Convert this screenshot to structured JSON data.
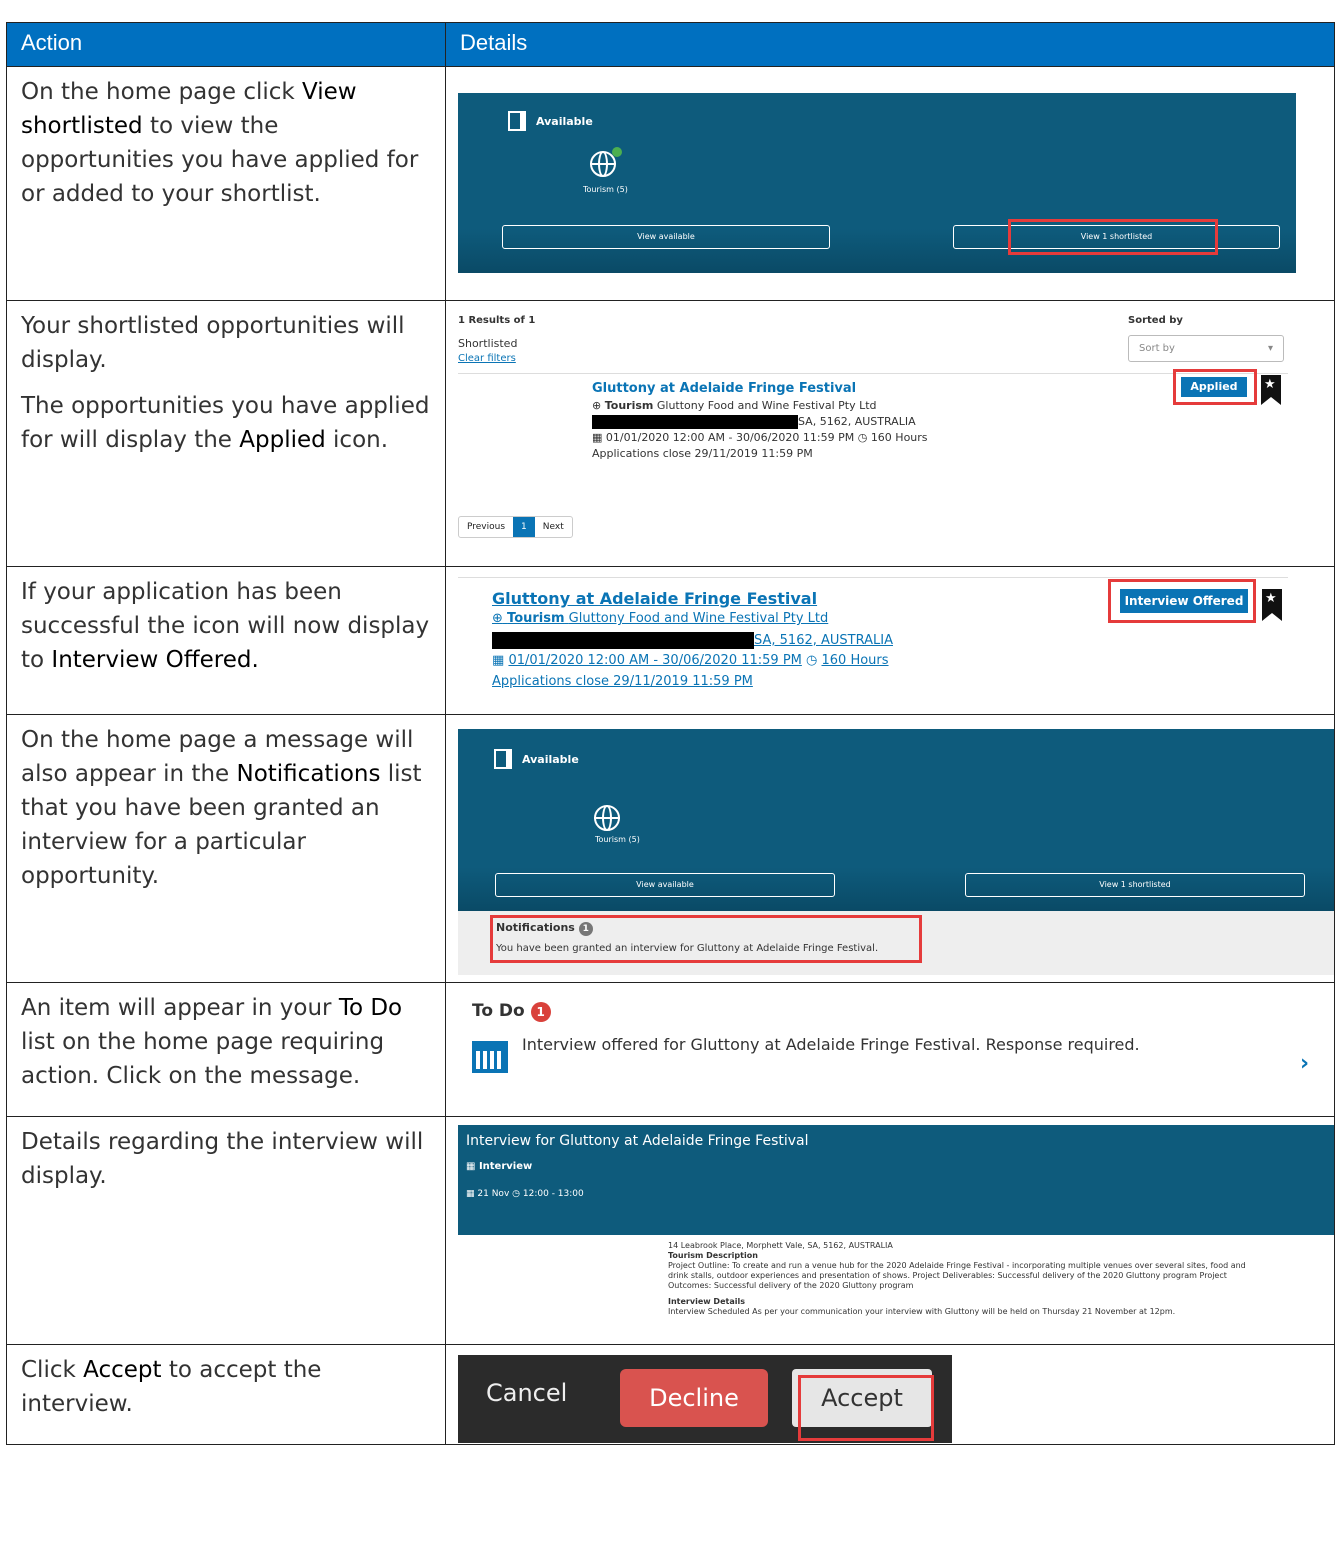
{
  "headers": {
    "action": "Action",
    "details": "Details"
  },
  "rows": {
    "r1": {
      "pre": "On the home page click ",
      "key": "View shortlisted",
      "post": " to view the opportunities you have applied for or added to your shortlist."
    },
    "r2": {
      "p1": "Your shortlisted opportunities will display.",
      "p2pre": "The opportunities you have applied for will display the ",
      "p2key": "Applied",
      "p2post": " icon."
    },
    "r3": {
      "pre": "If your application has been successful the icon will now display to ",
      "key": "Interview Offered."
    },
    "r4": {
      "pre": "On the home page a message will also appear in the ",
      "key": "Notifications",
      "post": " list that you have been granted an interview for a particular opportunity."
    },
    "r5": {
      "pre": "An item will appear in your ",
      "key": "To Do",
      "post": " list on the home page requiring action. Click on the message."
    },
    "r6": {
      "text": "Details regarding the interview will display."
    },
    "r7": {
      "key": "Accept",
      "post": " to accept the interview.",
      "pre": "Click "
    }
  },
  "home": {
    "available": "Available",
    "category": "Tourism (5)",
    "view_available": "View available",
    "view_shortlisted": "View 1 shortlisted"
  },
  "results": {
    "count": "1 Results of 1",
    "sorted_by": "Sorted by",
    "filter": "Shortlisted",
    "clear": "Clear filters",
    "sort_placeholder": "Sort by",
    "title": "Gluttony at Adelaide Fringe Festival",
    "category": "Tourism",
    "org": "Gluttony Food and Wine Festival Pty Ltd",
    "location": "SA, 5162, AUSTRALIA",
    "dates": "01/01/2020 12:00 AM - 30/06/2020 11:59 PM",
    "hours": "160 Hours",
    "closes": "Applications close 29/11/2019 11:59 PM",
    "status_applied": "Applied",
    "status_offered": "Interview Offered",
    "prev": "Previous",
    "page": "1",
    "next": "Next"
  },
  "notifications": {
    "title": "Notifications",
    "count": "1",
    "message": "You have been granted an interview for Gluttony at Adelaide Fringe Festival."
  },
  "todo": {
    "title": "To Do",
    "count": "1",
    "message": "Interview offered for Gluttony at Adelaide Fringe Festival. Response required."
  },
  "interview": {
    "title": "Interview for Gluttony at Adelaide Fringe Festival",
    "type": "Interview",
    "date": "21 Nov",
    "time": "12:00 - 13:00",
    "address": "14 Leabrook Place, Morphett Vale, SA, 5162, AUSTRALIA",
    "desc_title": "Tourism Description",
    "desc": "Project Outline: To create and run a venue hub for the 2020 Adelaide Fringe Festival - incorporating multiple venues over several sites, food and drink stalls, outdoor experiences and presentation of shows. Project Deliverables: Successful delivery of the 2020 Gluttony program Project Outcomes: Successful delivery of the 2020 Gluttony program",
    "details_title": "Interview Details",
    "details": "Interview Scheduled As per your communication your interview with Gluttony will be held on Thursday 21 November at 12pm."
  },
  "buttons": {
    "cancel": "Cancel",
    "decline": "Decline",
    "accept": "Accept"
  }
}
